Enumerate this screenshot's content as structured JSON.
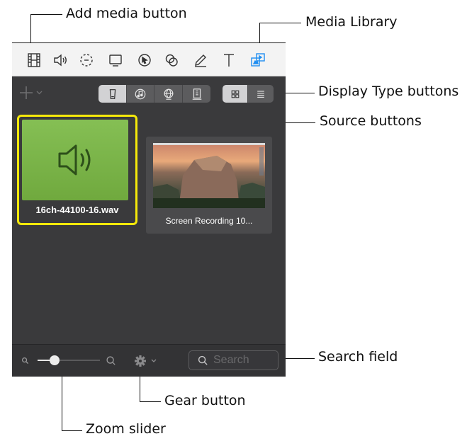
{
  "callouts": {
    "add_media": "Add media button",
    "media_library": "Media Library",
    "display_type": "Display Type buttons",
    "source": "Source buttons",
    "search_field": "Search field",
    "gear": "Gear button",
    "zoom": "Zoom slider"
  },
  "toolbar": {
    "tools": [
      {
        "icon": "film-strip-icon"
      },
      {
        "icon": "speaker-icon"
      },
      {
        "icon": "transition-icon"
      },
      {
        "icon": "screen-icon"
      },
      {
        "icon": "cursor-icon"
      },
      {
        "icon": "effects-icon"
      },
      {
        "icon": "pencil-icon"
      },
      {
        "icon": "text-icon"
      },
      {
        "icon": "media-library-icon",
        "active": true
      }
    ]
  },
  "source_buttons": [
    "phone-icon",
    "music-icon",
    "globe-icon",
    "building-icon"
  ],
  "display_buttons": [
    "grid-view-icon",
    "list-view-icon"
  ],
  "media": [
    {
      "name": "16ch-44100-16.wav",
      "kind": "audio",
      "selected": true
    },
    {
      "name": "Screen Recording 10...",
      "kind": "video",
      "selected": false
    }
  ],
  "search": {
    "placeholder": "Search",
    "value": ""
  },
  "zoom": {
    "level": 0.27
  },
  "colors": {
    "accent": "#1f8ef1",
    "selection": "#f5e90a",
    "audio_tile": "#7bb54a",
    "panel": "#3a3a3c"
  }
}
